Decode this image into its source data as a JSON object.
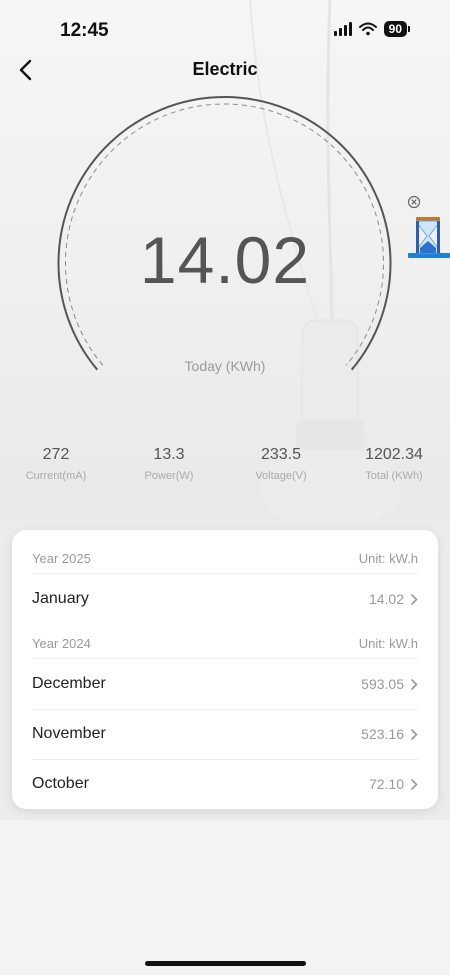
{
  "status_bar": {
    "time": "12:45",
    "battery": "90"
  },
  "nav": {
    "title": "Electric"
  },
  "gauge": {
    "value": "14.02",
    "label": "Today (KWh)"
  },
  "stats": [
    {
      "value": "272",
      "label": "Current(mA)"
    },
    {
      "value": "13.3",
      "label": "Power(W)"
    },
    {
      "value": "233.5",
      "label": "Voltage(V)"
    },
    {
      "value": "1202.34",
      "label": "Total (KWh)"
    }
  ],
  "history": {
    "y2025": {
      "year": "Year 2025",
      "unit": "Unit: kW.h",
      "months": [
        {
          "name": "January",
          "value": "14.02"
        }
      ]
    },
    "y2024": {
      "year": "Year 2024",
      "unit": "Unit: kW.h",
      "months": [
        {
          "name": "December",
          "value": "593.05"
        },
        {
          "name": "November",
          "value": "523.16"
        },
        {
          "name": "October",
          "value": "72.10"
        }
      ]
    }
  }
}
